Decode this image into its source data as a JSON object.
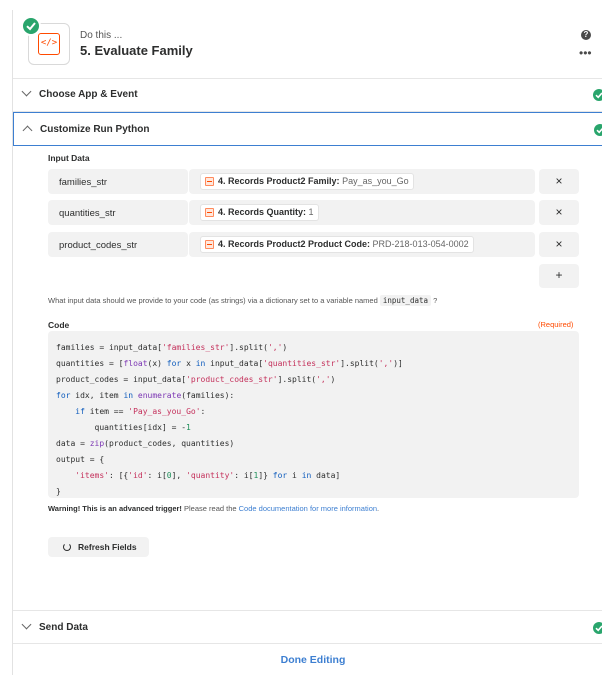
{
  "header": {
    "eyebrow": "Do this ...",
    "title": "5. Evaluate Family",
    "help_glyph": "?",
    "more_glyph": "•••",
    "app_icon_glyph": "</>"
  },
  "sections": {
    "choose": "Choose App & Event",
    "customize": "Customize Run Python",
    "send": "Send Data"
  },
  "input_data": {
    "title": "Input Data",
    "rows": [
      {
        "key": "families_str",
        "step": "4. Records Product2 Family:",
        "value": "Pay_as_you_Go"
      },
      {
        "key": "quantities_str",
        "step": "4. Records Quantity:",
        "value": "1"
      },
      {
        "key": "product_codes_str",
        "step": "4. Records Product2 Product Code:",
        "value": "PRD-218-013-054-0002"
      }
    ],
    "delete_glyph": "×",
    "add_glyph": "+",
    "help_before": "What input data should we provide to your code (as strings) via a dictionary set to a variable named",
    "help_code": "input_data",
    "help_after": "?"
  },
  "code": {
    "label": "Code",
    "required": "(Required)"
  },
  "warning": {
    "bold": "Warning! This is an advanced trigger!",
    "text": " Please read the ",
    "link": "Code documentation for more information",
    "end": "."
  },
  "refresh_label": "Refresh Fields",
  "done_label": "Done Editing",
  "colors": {
    "accent": "#3d7fd1",
    "success": "#29a56c",
    "brand": "#ff4a00"
  }
}
